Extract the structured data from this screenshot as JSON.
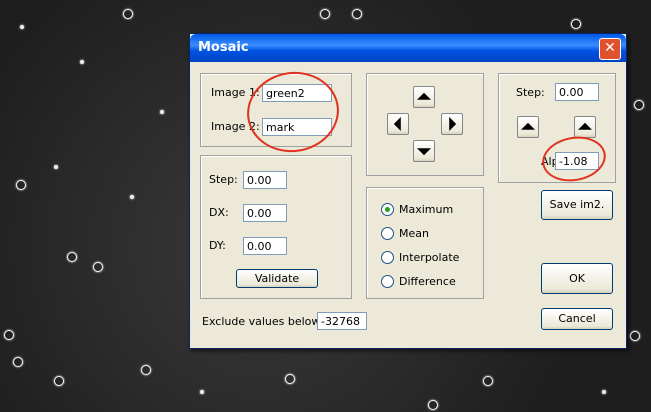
{
  "dialog": {
    "title": "Mosaic",
    "close_glyph": "✕",
    "images": {
      "image1_label": "Image 1:",
      "image1_value": "green2",
      "image2_label": "Image 2:",
      "image2_value": "mark"
    },
    "offset": {
      "step_label": "Step:",
      "step_value": "0.00",
      "dx_label": "DX:",
      "dx_value": "0.00",
      "dy_label": "DY:",
      "dy_value": "0.00",
      "validate_label": "Validate"
    },
    "modes": {
      "selected": "Maximum",
      "options": [
        "Maximum",
        "Mean",
        "Interpolate",
        "Difference"
      ]
    },
    "alpha_panel": {
      "step_label": "Step:",
      "step_value": "0.00",
      "alpha_label": "Alpha:",
      "alpha_value": "-1.08"
    },
    "save_label": "Save im2.",
    "ok_label": "OK",
    "cancel_label": "Cancel",
    "exclude_label": "Exclude values below:",
    "exclude_value": "-32768"
  },
  "colors": {
    "titlebar": "#0058e6",
    "dialog_bg": "#ece9d8",
    "annotation": "#e0321f",
    "radio_dot": "#21a121"
  }
}
